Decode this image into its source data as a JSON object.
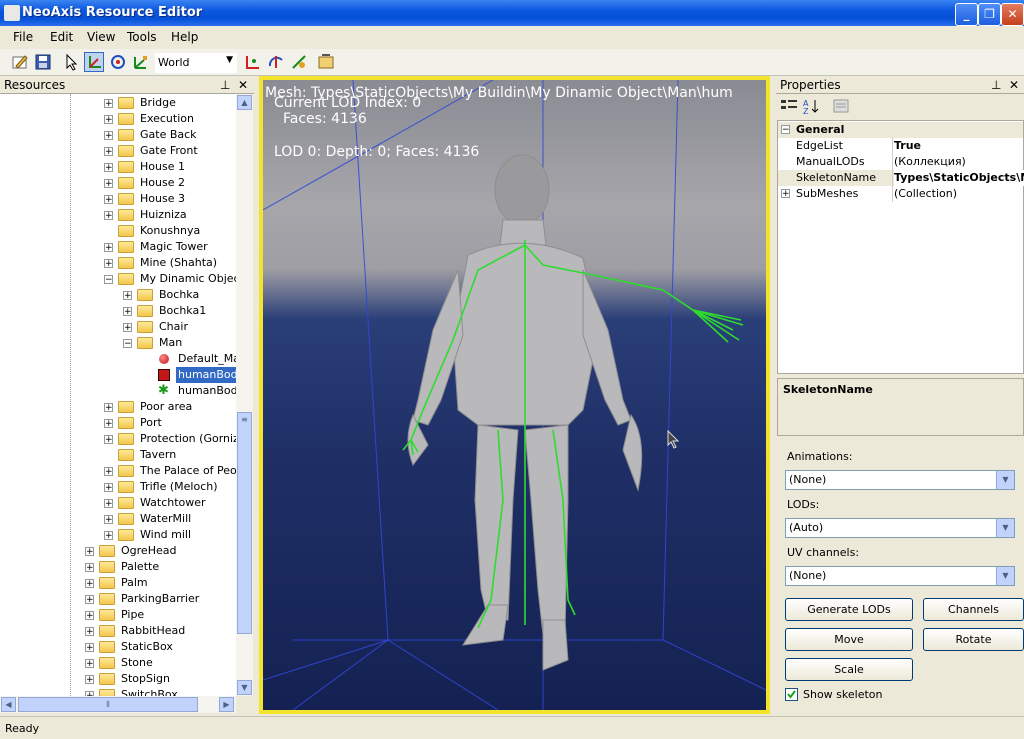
{
  "window": {
    "title": "NeoAxis Resource Editor"
  },
  "menu": [
    "File",
    "Edit",
    "View",
    "Tools",
    "Help"
  ],
  "toolbar": {
    "space_combo": "World"
  },
  "resources": {
    "title": "Resources",
    "items": [
      {
        "label": "Bridge",
        "depth": 1
      },
      {
        "label": "Execution",
        "depth": 1
      },
      {
        "label": "Gate Back",
        "depth": 1
      },
      {
        "label": "Gate Front",
        "depth": 1
      },
      {
        "label": "House 1",
        "depth": 1
      },
      {
        "label": "House 2",
        "depth": 1
      },
      {
        "label": "House 3",
        "depth": 1
      },
      {
        "label": "Huizniza",
        "depth": 1
      },
      {
        "label": "Konushnya",
        "depth": 1
      },
      {
        "label": "Magic Tower",
        "depth": 1
      },
      {
        "label": "Mine (Shahta)",
        "depth": 1
      },
      {
        "label": "My Dinamic Object",
        "depth": 1
      },
      {
        "label": "Bochka",
        "depth": 2
      },
      {
        "label": "Bochka1",
        "depth": 2
      },
      {
        "label": "Chair",
        "depth": 2
      },
      {
        "label": "Man",
        "depth": 2
      },
      {
        "label": "Default_Material",
        "depth": 3
      },
      {
        "label": "humanBody.mesh",
        "depth": 3
      },
      {
        "label": "humanBody.skeleton",
        "depth": 3
      },
      {
        "label": "Poor area",
        "depth": 1
      },
      {
        "label": "Port",
        "depth": 1
      },
      {
        "label": "Protection (Gornizon)",
        "depth": 1
      },
      {
        "label": "Tavern",
        "depth": 1
      },
      {
        "label": "The Palace of People",
        "depth": 1
      },
      {
        "label": "Trifle (Meloch)",
        "depth": 1
      },
      {
        "label": "Watchtower",
        "depth": 1
      },
      {
        "label": "WaterMill",
        "depth": 1
      },
      {
        "label": "Wind mill",
        "depth": 1
      },
      {
        "label": "OgreHead",
        "depth": 0
      },
      {
        "label": "Palette",
        "depth": 0
      },
      {
        "label": "Palm",
        "depth": 0
      },
      {
        "label": "ParkingBarrier",
        "depth": 0
      },
      {
        "label": "Pipe",
        "depth": 0
      },
      {
        "label": "RabbitHead",
        "depth": 0
      },
      {
        "label": "StaticBox",
        "depth": 0
      },
      {
        "label": "Stone",
        "depth": 0
      },
      {
        "label": "StopSign",
        "depth": 0
      },
      {
        "label": "SwitchBox",
        "depth": 0
      }
    ]
  },
  "viewport": {
    "mesh_path": "Mesh: Types\\StaticObjects\\My Buildin\\My Dinamic Object\\Man\\hum",
    "lod_index": "Current LOD Index: 0",
    "faces": "Faces: 4136",
    "lod_info": "LOD 0: Depth: 0; Faces: 4136"
  },
  "properties": {
    "title": "Properties",
    "category": "General",
    "rows": [
      {
        "key": "EdgeList",
        "value": "True"
      },
      {
        "key": "ManualLODs",
        "value": "(Коллекция)"
      },
      {
        "key": "SkeletonName",
        "value": "Types\\StaticObjects\\M"
      },
      {
        "key": "SubMeshes",
        "value": "(Collection)"
      }
    ],
    "description_title": "SkeletonName",
    "animations_label": "Animations:",
    "animations_value": "(None)",
    "lods_label": "LODs:",
    "lods_value": "(Auto)",
    "uv_label": "UV channels:",
    "uv_value": "(None)",
    "buttons": {
      "generate_lods": "Generate LODs",
      "channels": "Channels",
      "move": "Move",
      "rotate": "Rotate",
      "scale": "Scale"
    },
    "show_skeleton": "Show skeleton"
  },
  "status": "Ready"
}
